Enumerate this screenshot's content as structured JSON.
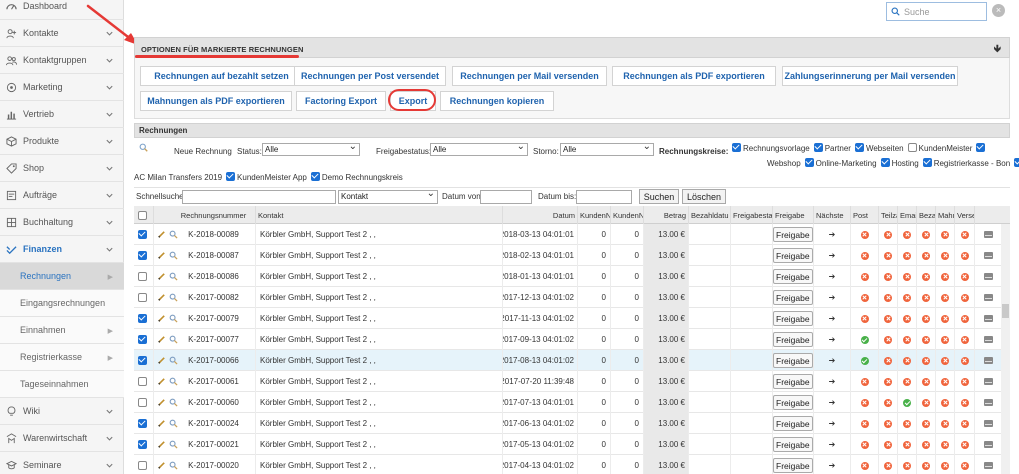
{
  "sidebar": {
    "items": [
      {
        "label": "Dashboard",
        "icon": "dashboard-icon",
        "chevron": false
      },
      {
        "label": "Kontakte",
        "icon": "contacts-icon",
        "chevron": true
      },
      {
        "label": "Kontaktgruppen",
        "icon": "contact-groups-icon",
        "chevron": true
      },
      {
        "label": "Marketing",
        "icon": "marketing-icon",
        "chevron": true
      },
      {
        "label": "Vertrieb",
        "icon": "sales-chart-icon",
        "chevron": true
      },
      {
        "label": "Produkte",
        "icon": "products-box-icon",
        "chevron": true
      },
      {
        "label": "Shop",
        "icon": "shop-tag-icon",
        "chevron": true
      },
      {
        "label": "Aufträge",
        "icon": "orders-icon",
        "chevron": true
      },
      {
        "label": "Buchhaltung",
        "icon": "accounting-icon",
        "chevron": true
      },
      {
        "label": "Finanzen",
        "icon": "finance-icon",
        "chevron": true
      }
    ],
    "sub_items": [
      {
        "label": "Rechnungen",
        "active": true,
        "arrow": true
      },
      {
        "label": "Eingangsrechnungen",
        "active": false,
        "arrow": false
      },
      {
        "label": "Einnahmen",
        "active": false,
        "arrow": true
      },
      {
        "label": "Registrierkasse",
        "active": false,
        "arrow": true
      },
      {
        "label": "Tageseinnahmen",
        "active": false,
        "arrow": false
      }
    ],
    "bottom_items": [
      {
        "label": "Wiki",
        "icon": "wiki-bulb-icon"
      },
      {
        "label": "Warenwirtschaft",
        "icon": "warehouse-icon"
      },
      {
        "label": "Seminare",
        "icon": "seminar-icon"
      }
    ]
  },
  "search": {
    "placeholder": "Suche"
  },
  "options": {
    "title": "OPTIONEN FÜR MARKIERTE RECHNUNGEN",
    "buttons_row1": [
      "Rechnungen auf bezahlt setzen",
      "Rechnungen per Post versendet",
      "Rechnungen per Mail versenden",
      "Rechnungen als PDF exportieren",
      "Zahlungserinnerung per Mail versenden"
    ],
    "buttons_row2": [
      "Mahnungen als PDF exportieren",
      "Factoring Export",
      "Export",
      "Rechnungen kopieren"
    ]
  },
  "table_panel": {
    "title": "Rechnungen",
    "new_invoice": "Neue Rechnung",
    "status_label": "Status:",
    "status_value": "Alle",
    "freigabe_label": "Freigabestatus:",
    "freigabe_value": "Alle",
    "storno_label": "Storno:",
    "storno_value": "Alle",
    "kreise_label": "Rechnungskreise:",
    "kreise": [
      {
        "label": "Rechnungsvorlage",
        "checked": true
      },
      {
        "label": "Partner",
        "checked": true
      },
      {
        "label": "Webseiten",
        "checked": true
      },
      {
        "label": "KundenMeister",
        "checked": false
      },
      {
        "label": "",
        "checked": true
      },
      {
        "label": "Webshop",
        "checked": true,
        "prefix_only": true
      },
      {
        "label": "Online-Marketing",
        "checked": true
      },
      {
        "label": "Hosting",
        "checked": true
      },
      {
        "label": "Registrierkasse - Bon",
        "checked": true
      },
      {
        "label": "Registrierkasse - Bon",
        "checked": true
      },
      {
        "label": "",
        "checked": true
      }
    ],
    "row3_text": "AC Milan Transfers 2019",
    "row3_checks": [
      {
        "label": "KundenMeister App",
        "checked": true
      },
      {
        "label": "Demo Rechnungskreis",
        "checked": true
      }
    ],
    "schnellsuche": "Schnellsuche",
    "kontakt_value": "Kontakt",
    "datum_von": "Datum von:",
    "datum_bis": "Datum bis:",
    "suchen": "Suchen",
    "loeschen": "Löschen"
  },
  "columns": [
    "Rechnungsnummer",
    "Kontakt",
    "Datum",
    "KundenN",
    "KundenN",
    "Betrag",
    "Bezahldatu",
    "Freigabesta",
    "Freigabe",
    "Nächste",
    "Post",
    "Teilza",
    "Emai",
    "Bezahl",
    "Mahnst",
    "Versenden"
  ],
  "freigabe_btn": "Freigabe",
  "rows": [
    {
      "checked": true,
      "nr": "K-2018-00089",
      "kontakt": "Körbler GmbH, Support Test 2 , ,",
      "datum": "2018-03-13 04:01:01",
      "k1": "0",
      "k2": "0",
      "betrag": "13.00 €",
      "status": [
        "x",
        "x",
        "x",
        "x",
        "x"
      ],
      "sel": false
    },
    {
      "checked": true,
      "nr": "K-2018-00087",
      "kontakt": "Körbler GmbH, Support Test 2 , ,",
      "datum": "2018-02-13 04:01:01",
      "k1": "0",
      "k2": "0",
      "betrag": "13.00 €",
      "status": [
        "x",
        "x",
        "x",
        "x",
        "x"
      ],
      "sel": false
    },
    {
      "checked": false,
      "nr": "K-2018-00086",
      "kontakt": "Körbler GmbH, Support Test 2 , ,",
      "datum": "2018-01-13 04:01:01",
      "k1": "0",
      "k2": "0",
      "betrag": "13.00 €",
      "status": [
        "x",
        "x",
        "x",
        "x",
        "x"
      ],
      "sel": false
    },
    {
      "checked": false,
      "nr": "K-2017-00082",
      "kontakt": "Körbler GmbH, Support Test 2 , ,",
      "datum": "2017-12-13 04:01:02",
      "k1": "0",
      "k2": "0",
      "betrag": "13.00 €",
      "status": [
        "x",
        "x",
        "x",
        "x",
        "x"
      ],
      "sel": false
    },
    {
      "checked": true,
      "nr": "K-2017-00079",
      "kontakt": "Körbler GmbH, Support Test 2 , ,",
      "datum": "2017-11-13 04:01:02",
      "k1": "0",
      "k2": "0",
      "betrag": "13.00 €",
      "status": [
        "x",
        "x",
        "x",
        "x",
        "x"
      ],
      "sel": false
    },
    {
      "checked": true,
      "nr": "K-2017-00077",
      "kontakt": "Körbler GmbH, Support Test 2 , ,",
      "datum": "2017-09-13 04:01:02",
      "k1": "0",
      "k2": "0",
      "betrag": "13.00 €",
      "status": [
        "ok",
        "x",
        "x",
        "x",
        "x"
      ],
      "sel": false
    },
    {
      "checked": true,
      "nr": "K-2017-00066",
      "kontakt": "Körbler GmbH, Support Test 2 , ,",
      "datum": "2017-08-13 04:01:02",
      "k1": "0",
      "k2": "0",
      "betrag": "13.00 €",
      "status": [
        "ok",
        "x",
        "x",
        "x",
        "x"
      ],
      "sel": true
    },
    {
      "checked": false,
      "nr": "K-2017-00061",
      "kontakt": "Körbler GmbH, Support Test 2 , ,",
      "datum": "2017-07-20 11:39:48",
      "k1": "0",
      "k2": "0",
      "betrag": "13.00 €",
      "status": [
        "x",
        "x",
        "x",
        "x",
        "x"
      ],
      "sel": false
    },
    {
      "checked": false,
      "nr": "K-2017-00060",
      "kontakt": "Körbler GmbH, Support Test 2 , ,",
      "datum": "2017-07-13 04:01:01",
      "k1": "0",
      "k2": "0",
      "betrag": "13.00 €",
      "status": [
        "x",
        "x",
        "ok",
        "x",
        "x"
      ],
      "sel": false
    },
    {
      "checked": true,
      "nr": "K-2017-00024",
      "kontakt": "Körbler GmbH, Support Test 2 , ,",
      "datum": "2017-06-13 04:01:02",
      "k1": "0",
      "k2": "0",
      "betrag": "13.00 €",
      "status": [
        "x",
        "x",
        "x",
        "x",
        "x"
      ],
      "sel": false
    },
    {
      "checked": true,
      "nr": "K-2017-00021",
      "kontakt": "Körbler GmbH, Support Test 2 , ,",
      "datum": "2017-05-13 04:01:02",
      "k1": "0",
      "k2": "0",
      "betrag": "13.00 €",
      "status": [
        "x",
        "x",
        "x",
        "x",
        "x"
      ],
      "sel": false
    },
    {
      "checked": false,
      "nr": "K-2017-00020",
      "kontakt": "Körbler GmbH, Support Test 2 , ,",
      "datum": "2017-04-13 04:01:02",
      "k1": "0",
      "k2": "0",
      "betrag": "13.00 €",
      "status": [
        "x",
        "x",
        "x",
        "x",
        "x"
      ],
      "sel": false
    }
  ],
  "colors": {
    "accent": "#2a73c0",
    "highlight": "#e53935",
    "status_red": "#f0643c",
    "status_green": "#49b14a",
    "checkbox_blue": "#1a6fd4"
  }
}
